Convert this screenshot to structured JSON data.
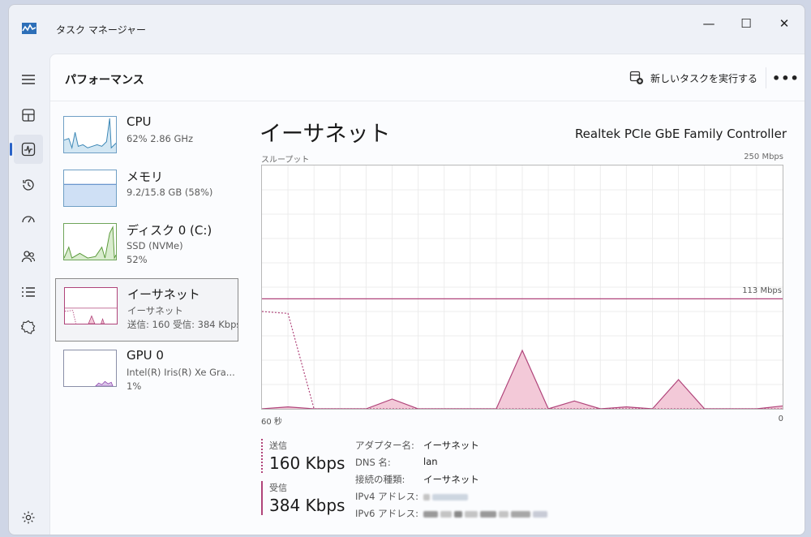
{
  "window": {
    "title": "タスク マネージャー",
    "controls": {
      "minimize": "—",
      "maximize": "☐",
      "close": "✕"
    }
  },
  "header": {
    "page_title": "パフォーマンス",
    "run_new_task": "新しいタスクを実行する",
    "more": "•••"
  },
  "nav": {
    "items": [
      "menu-icon",
      "processes-icon",
      "performance-icon",
      "app-history-icon",
      "startup-icon",
      "users-icon",
      "details-icon",
      "services-icon"
    ],
    "settings": "gear-icon",
    "selected": "performance-icon"
  },
  "sidebar": {
    "cards": [
      {
        "name": "CPU",
        "line1": "62%  2.86 GHz",
        "line2": "",
        "color": "#4a90b8"
      },
      {
        "name": "メモリ",
        "line1": "9.2/15.8 GB (58%)",
        "line2": "",
        "color": "#5b8ec8"
      },
      {
        "name": "ディスク 0 (C:)",
        "line1": "SSD (NVMe)",
        "line2": "52%",
        "color": "#5fa43c"
      },
      {
        "name": "イーサネット",
        "line1": "イーサネット",
        "line2": "送信: 160  受信: 384 Kbps",
        "color": "#b0447a",
        "selected": true
      },
      {
        "name": "GPU 0",
        "line1": "Intel(R) Iris(R) Xe Gra...",
        "line2": "1%",
        "color": "#8e44ad"
      }
    ]
  },
  "main": {
    "title": "イーサネット",
    "adapter_name": "Realtek PCIe GbE Family Controller",
    "graph_label": "スループット",
    "graph_max": "250 Mbps",
    "scale_marker": "113 Mbps",
    "axis_left": "60 秒",
    "axis_right": "0",
    "send_label": "送信",
    "send_value": "160 Kbps",
    "recv_label": "受信",
    "recv_value": "384 Kbps",
    "properties": [
      {
        "label": "アダプター名:",
        "value": "イーサネット"
      },
      {
        "label": "DNS 名:",
        "value": "lan"
      },
      {
        "label": "接続の種類:",
        "value": "イーサネット"
      },
      {
        "label": "IPv4 アドレス:",
        "value": ""
      },
      {
        "label": "IPv6 アドレス:",
        "value": ""
      }
    ]
  },
  "chart_data": {
    "type": "area",
    "title": "スループット",
    "ylim": [
      0,
      250
    ],
    "y_unit": "Mbps",
    "scale_marker": 113,
    "x": [
      60,
      57,
      54,
      51,
      48,
      45,
      42,
      39,
      36,
      33,
      30,
      27,
      24,
      21,
      18,
      15,
      12,
      9,
      6,
      3,
      0
    ],
    "series": [
      {
        "name": "受信",
        "style": "solid",
        "values": [
          0,
          2,
          0,
          0,
          0,
          10,
          0,
          0,
          0,
          0,
          60,
          0,
          8,
          0,
          2,
          0,
          30,
          0,
          0,
          0,
          3
        ]
      },
      {
        "name": "送信",
        "style": "dotted",
        "values": [
          100,
          98,
          0,
          0,
          0,
          0,
          0,
          0,
          0,
          0,
          0,
          0,
          0,
          0,
          0,
          0,
          0,
          0,
          0,
          0,
          0
        ]
      }
    ],
    "colors": {
      "line": "#b0447a",
      "fill": "#f3c9d8",
      "grid": "#ececec"
    },
    "grid": true
  }
}
